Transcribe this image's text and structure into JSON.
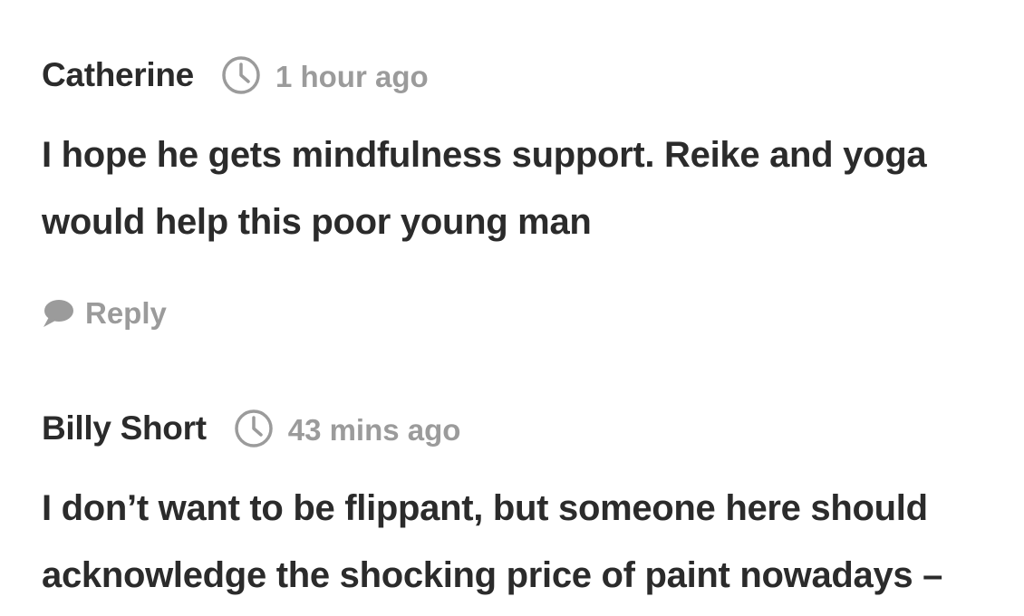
{
  "comments": [
    {
      "author": "Catherine",
      "time": "1 hour ago",
      "body_lines": [
        "I hope he gets mindfulness support. Reike and yoga",
        "would help this poor young man"
      ],
      "reply_label": "Reply"
    },
    {
      "author": "Billy Short",
      "time": "43 mins ago",
      "body_lines": [
        "I don’t want to be flippant, but someone here should",
        "acknowledge the shocking price of paint nowadays –"
      ]
    }
  ],
  "icons": {
    "clock": "clock-icon",
    "reply": "speech-bubble-icon"
  },
  "colors": {
    "text": "#2b2b2b",
    "muted": "#9b9b9b",
    "background": "#ffffff"
  }
}
